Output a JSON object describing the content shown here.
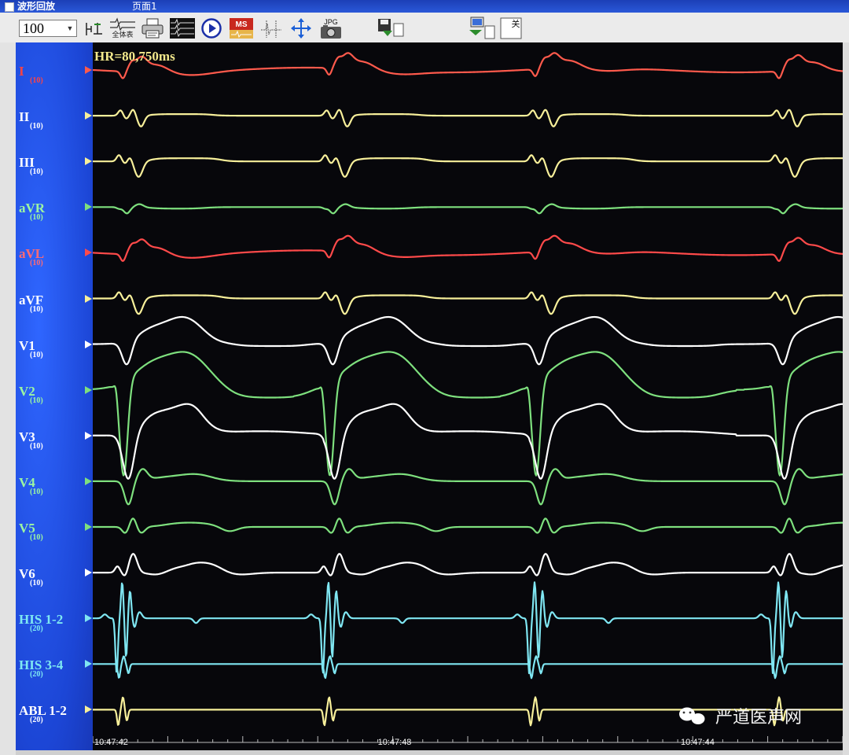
{
  "window": {
    "title": "波形回放",
    "page_label": "页面1"
  },
  "toolbar": {
    "zoom": "100",
    "buttons": [
      {
        "id": "calipers",
        "icon": "caliper-icon"
      },
      {
        "id": "all-leads",
        "icon": "waveform-icon",
        "label": "全体表"
      },
      {
        "id": "print",
        "icon": "printer-icon"
      },
      {
        "id": "layout",
        "icon": "grid-icon"
      },
      {
        "id": "play",
        "icon": "play-icon"
      },
      {
        "id": "measure",
        "icon": "ms-measure-icon",
        "label": "MS"
      },
      {
        "id": "marker",
        "icon": "marker-icon"
      },
      {
        "id": "move",
        "icon": "move-arrows-icon"
      },
      {
        "id": "jpg",
        "icon": "camera-icon",
        "label": "JPG"
      },
      {
        "id": "save",
        "icon": "save-icon"
      },
      {
        "id": "export",
        "icon": "computer-icon"
      },
      {
        "id": "close",
        "icon": "close-icon",
        "label": "关"
      }
    ]
  },
  "recording": {
    "heart_rate_text": "HR=80,750ms",
    "time_labels": [
      "10:47:42",
      "10:47:43",
      "10:47:44"
    ],
    "beat_times": [
      0.035,
      0.31,
      0.585,
      0.91
    ]
  },
  "leads": [
    {
      "name": "I",
      "gain": "(10)",
      "label_color": "#ff4444",
      "trace_color": "#ff5a4c",
      "morph": "limb_up"
    },
    {
      "name": "II",
      "gain": "(10)",
      "label_color": "#ffffff",
      "trace_color": "#f7ef9a",
      "morph": "limb_bi"
    },
    {
      "name": "III",
      "gain": "(10)",
      "label_color": "#ffffff",
      "trace_color": "#f7ef9a",
      "morph": "limb_down"
    },
    {
      "name": "aVR",
      "gain": "(10)",
      "label_color": "#9cf5a2",
      "trace_color": "#7ee07e",
      "morph": "avr"
    },
    {
      "name": "aVL",
      "gain": "(10)",
      "label_color": "#ff6a74",
      "trace_color": "#ff4a4a",
      "morph": "limb_up"
    },
    {
      "name": "aVF",
      "gain": "(10)",
      "label_color": "#ffffff",
      "trace_color": "#f7ef9a",
      "morph": "limb_down"
    },
    {
      "name": "V1",
      "gain": "(10)",
      "label_color": "#ffffff",
      "trace_color": "#ffffff",
      "morph": "v1"
    },
    {
      "name": "V2",
      "gain": "(10)",
      "label_color": "#9cf5a2",
      "trace_color": "#7ee07e",
      "morph": "v2"
    },
    {
      "name": "V3",
      "gain": "(10)",
      "label_color": "#ffffff",
      "trace_color": "#ffffff",
      "morph": "v3"
    },
    {
      "name": "V4",
      "gain": "(10)",
      "label_color": "#9cf5a2",
      "trace_color": "#7ee07e",
      "morph": "v4"
    },
    {
      "name": "V5",
      "gain": "(10)",
      "label_color": "#9cf5a2",
      "trace_color": "#7ee07e",
      "morph": "v5"
    },
    {
      "name": "V6",
      "gain": "(10)",
      "label_color": "#ffffff",
      "trace_color": "#ffffff",
      "morph": "v6"
    },
    {
      "name": "HIS 1-2",
      "gain": "(20)",
      "label_color": "#7ee8f2",
      "trace_color": "#7fe6f2",
      "morph": "his12"
    },
    {
      "name": "HIS 3-4",
      "gain": "(20)",
      "label_color": "#7ee8f2",
      "trace_color": "#7fe6f2",
      "morph": "his34"
    },
    {
      "name": "ABL 1-2",
      "gain": "(20)",
      "label_color": "#ffffff",
      "trace_color": "#f7ef9a",
      "morph": "abl"
    }
  ],
  "watermark": "严道医声网"
}
